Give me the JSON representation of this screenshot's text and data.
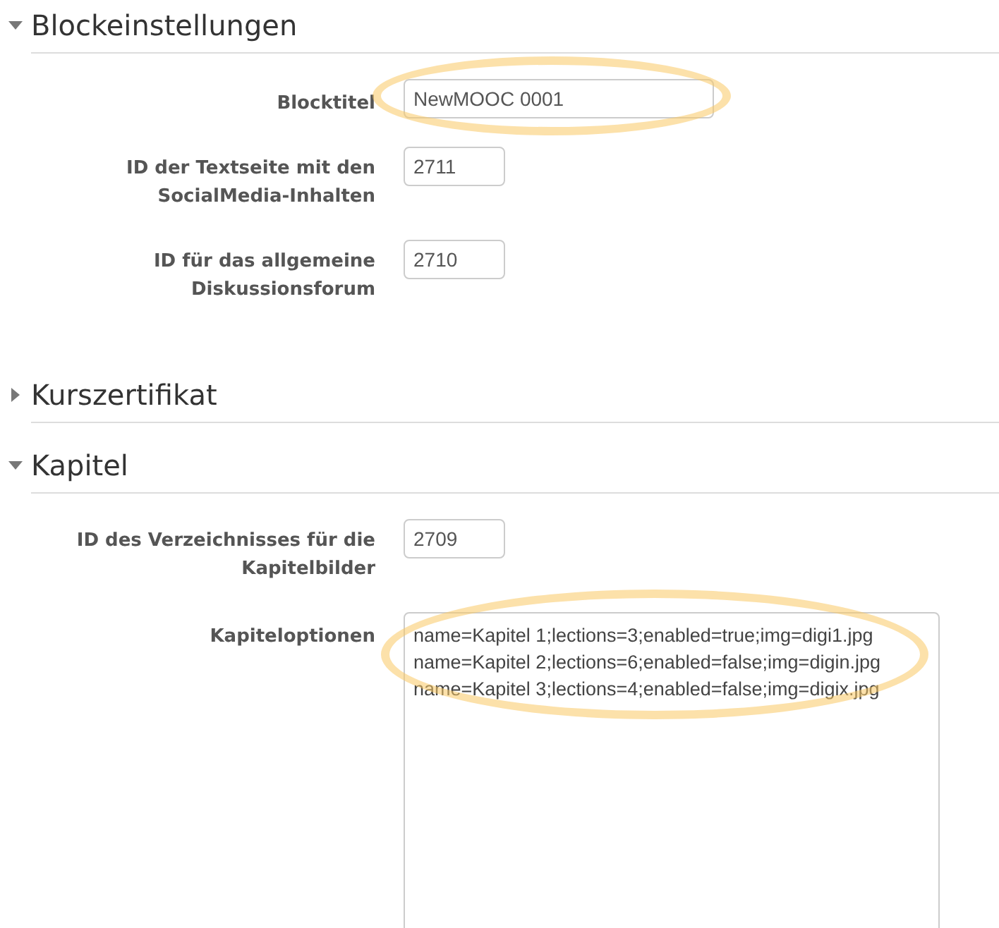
{
  "sections": [
    {
      "title": "Blockeinstellungen",
      "expanded": true,
      "fields": [
        {
          "label": "Blocktitel",
          "kind": "text",
          "value": "NewMOOC 0001",
          "highlighted": true
        },
        {
          "label": "ID der Textseite mit den SocialMedia-Inhalten",
          "kind": "number",
          "value": "2711",
          "highlighted": false
        },
        {
          "label": "ID für das allgemeine Diskussionsforum",
          "kind": "number",
          "value": "2710",
          "highlighted": false
        }
      ]
    },
    {
      "title": "Kurszertifikat",
      "expanded": false
    },
    {
      "title": "Kapitel",
      "expanded": true,
      "fields": [
        {
          "label": "ID des Verzeichnisses für die Kapitelbilder",
          "kind": "number",
          "value": "2709",
          "highlighted": false
        },
        {
          "label": "Kapiteloptionen",
          "kind": "textarea",
          "value": "name=Kapitel 1;lections=3;enabled=true;img=digi1.jpg\nname=Kapitel 2;lections=6;enabled=false;img=digin.jpg\nname=Kapitel 3;lections=4;enabled=false;img=digix.jpg",
          "highlighted": true
        }
      ]
    }
  ]
}
